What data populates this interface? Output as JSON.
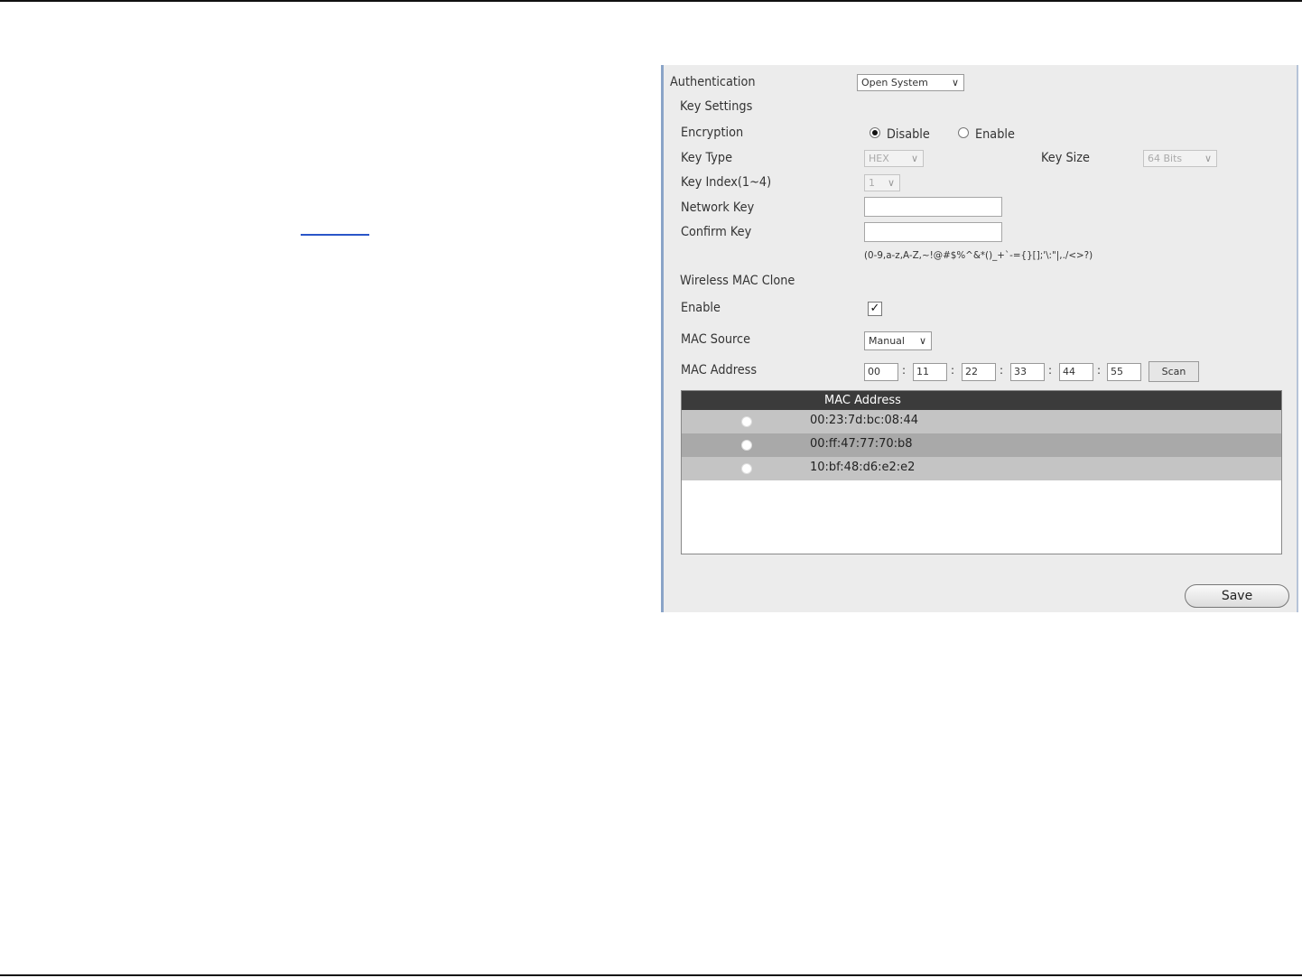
{
  "wireless_security": {
    "authentication": {
      "label": "Authentication",
      "value": "Open System"
    },
    "key_settings_label": "Key Settings",
    "encryption": {
      "label": "Encryption",
      "disable_label": "Disable",
      "enable_label": "Enable",
      "selected": "Disable"
    },
    "key_type": {
      "label": "Key Type",
      "value": "HEX"
    },
    "key_size": {
      "label": "Key Size",
      "value": "64 Bits"
    },
    "key_index": {
      "label": "Key Index(1~4)",
      "value": "1"
    },
    "network_key": {
      "label": "Network Key",
      "value": ""
    },
    "confirm_key": {
      "label": "Confirm Key",
      "value": ""
    },
    "key_hint": "(0-9,a-z,A-Z,~!@#$%^&*()_+`-={}[];'\\:\"|,./<>?)"
  },
  "mac_clone": {
    "section_label": "Wireless MAC Clone",
    "enable": {
      "label": "Enable",
      "checked": true,
      "check_glyph": "✓"
    },
    "mac_source": {
      "label": "MAC Source",
      "value": "Manual"
    },
    "mac_address": {
      "label": "MAC Address",
      "octets": [
        "00",
        "11",
        "22",
        "33",
        "44",
        "55"
      ],
      "separator": ":"
    },
    "scan_label": "Scan",
    "table": {
      "header": "MAC Address",
      "rows": [
        {
          "address": "00:23:7d:bc:08:44"
        },
        {
          "address": "00:ff:47:77:70:b8"
        },
        {
          "address": "10:bf:48:d6:e2:e2"
        }
      ]
    }
  },
  "save_label": "Save",
  "colors": {
    "table_header": "#3b3b3b",
    "panel_bg": "#ececec",
    "link_underline": "#2a55c8"
  }
}
